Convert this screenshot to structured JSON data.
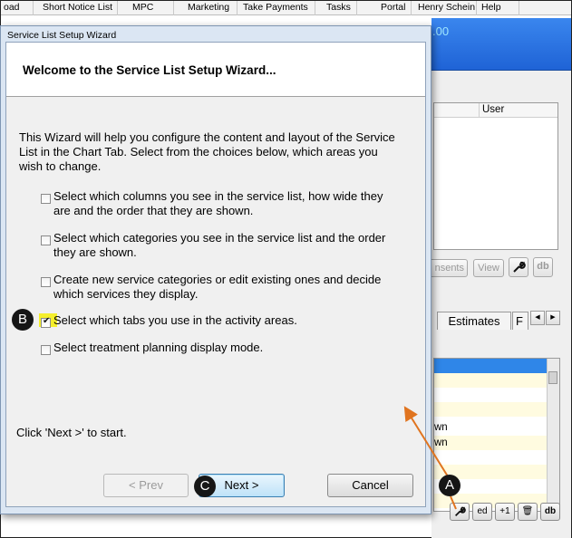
{
  "menu": {
    "items": [
      "oad",
      "Short Notice List",
      "MPC",
      "Marketing",
      "Take Payments",
      "Tasks",
      "Portal",
      "Henry Schein",
      "Help"
    ]
  },
  "background": {
    "header_value": ".00",
    "grid_column_user": "User",
    "buttons": {
      "consents": "nsents",
      "view": "View",
      "db": "db"
    },
    "tabs": {
      "estimates": "Estimates",
      "next_tab": "F"
    },
    "list_rows": [
      "",
      "",
      "",
      "",
      "wn",
      "wn",
      "",
      "",
      "",
      ""
    ],
    "tool_buttons": {
      "chart": "+1",
      "db": "db",
      "edit": "ed"
    }
  },
  "dialog": {
    "title": "Service List Setup Wizard",
    "heading": "Welcome to the Service List Setup Wizard...",
    "intro": "This Wizard will help you configure the content and layout of the Service List in the Chart Tab. Select from the choices below, which areas you wish to change.",
    "options": [
      {
        "label": "Select which columns you see in the service list, how wide they are and the order that they are shown.",
        "checked": false
      },
      {
        "label": "Select which categories you see in the service list and the order they are shown.",
        "checked": false
      },
      {
        "label": "Create new service categories or edit existing ones and decide which services they display.",
        "checked": false
      },
      {
        "label": "Select which tabs you use in the activity areas.",
        "checked": true
      },
      {
        "label": "Select treatment planning display mode.",
        "checked": false
      }
    ],
    "start_hint": "Click 'Next >' to start.",
    "buttons": {
      "prev": "< Prev",
      "next": "Next >",
      "cancel": "Cancel"
    }
  },
  "callouts": {
    "a": "A",
    "b": "B",
    "c": "C"
  },
  "colors": {
    "highlight": "#f5ef2c",
    "arrow": "#e0741f",
    "header_blue": "#2a74e4"
  }
}
